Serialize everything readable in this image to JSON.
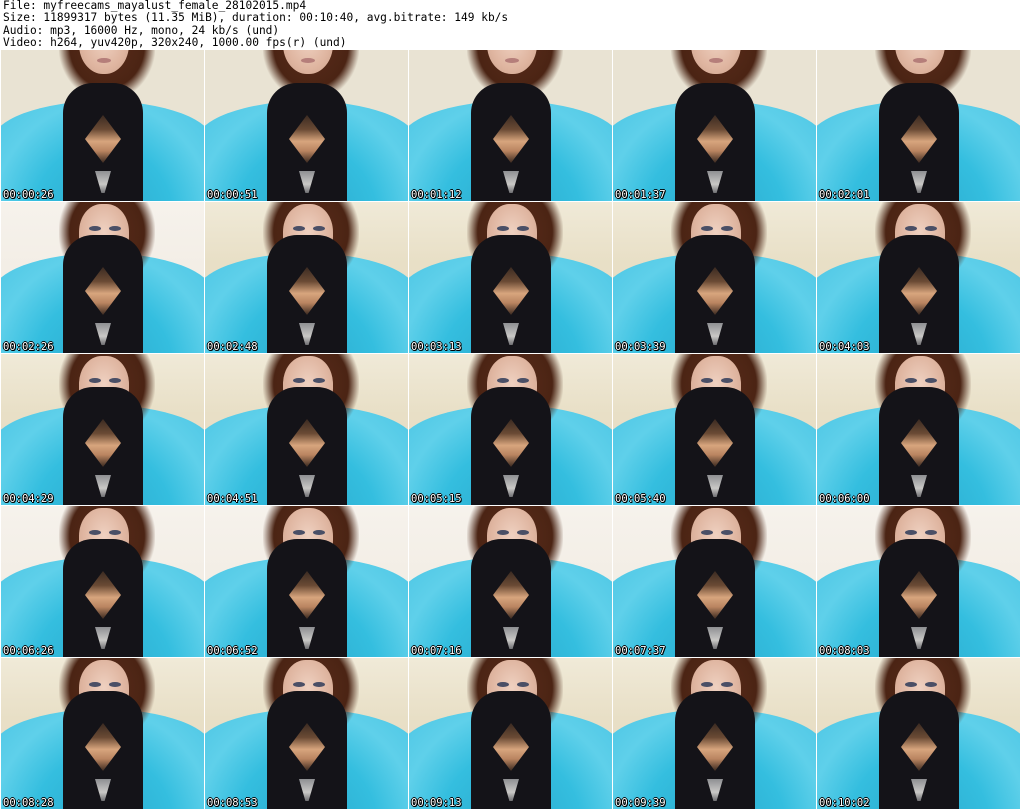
{
  "header": {
    "file_line": "File: myfreecams_mayalust_female_28102015.mp4",
    "size_line": "Size: 11899317 bytes (11.35 MiB), duration: 00:10:40, avg.bitrate: 149 kb/s",
    "audio_line": "Audio: mp3, 16000 Hz, mono, 24 kb/s (und)",
    "video_line": "Video: h264, yuv420p, 320x240, 1000.00 fps(r) (und)"
  },
  "thumbnails": [
    {
      "timestamp": "00:00:26"
    },
    {
      "timestamp": "00:00:51"
    },
    {
      "timestamp": "00:01:12"
    },
    {
      "timestamp": "00:01:37"
    },
    {
      "timestamp": "00:02:01"
    },
    {
      "timestamp": "00:02:26"
    },
    {
      "timestamp": "00:02:48"
    },
    {
      "timestamp": "00:03:13"
    },
    {
      "timestamp": "00:03:39"
    },
    {
      "timestamp": "00:04:03"
    },
    {
      "timestamp": "00:04:29"
    },
    {
      "timestamp": "00:04:51"
    },
    {
      "timestamp": "00:05:15"
    },
    {
      "timestamp": "00:05:40"
    },
    {
      "timestamp": "00:06:00"
    },
    {
      "timestamp": "00:06:26"
    },
    {
      "timestamp": "00:06:52"
    },
    {
      "timestamp": "00:07:16"
    },
    {
      "timestamp": "00:07:37"
    },
    {
      "timestamp": "00:08:03"
    },
    {
      "timestamp": "00:08:28"
    },
    {
      "timestamp": "00:08:53"
    },
    {
      "timestamp": "00:09:13"
    },
    {
      "timestamp": "00:09:39"
    },
    {
      "timestamp": "00:10:02"
    }
  ]
}
